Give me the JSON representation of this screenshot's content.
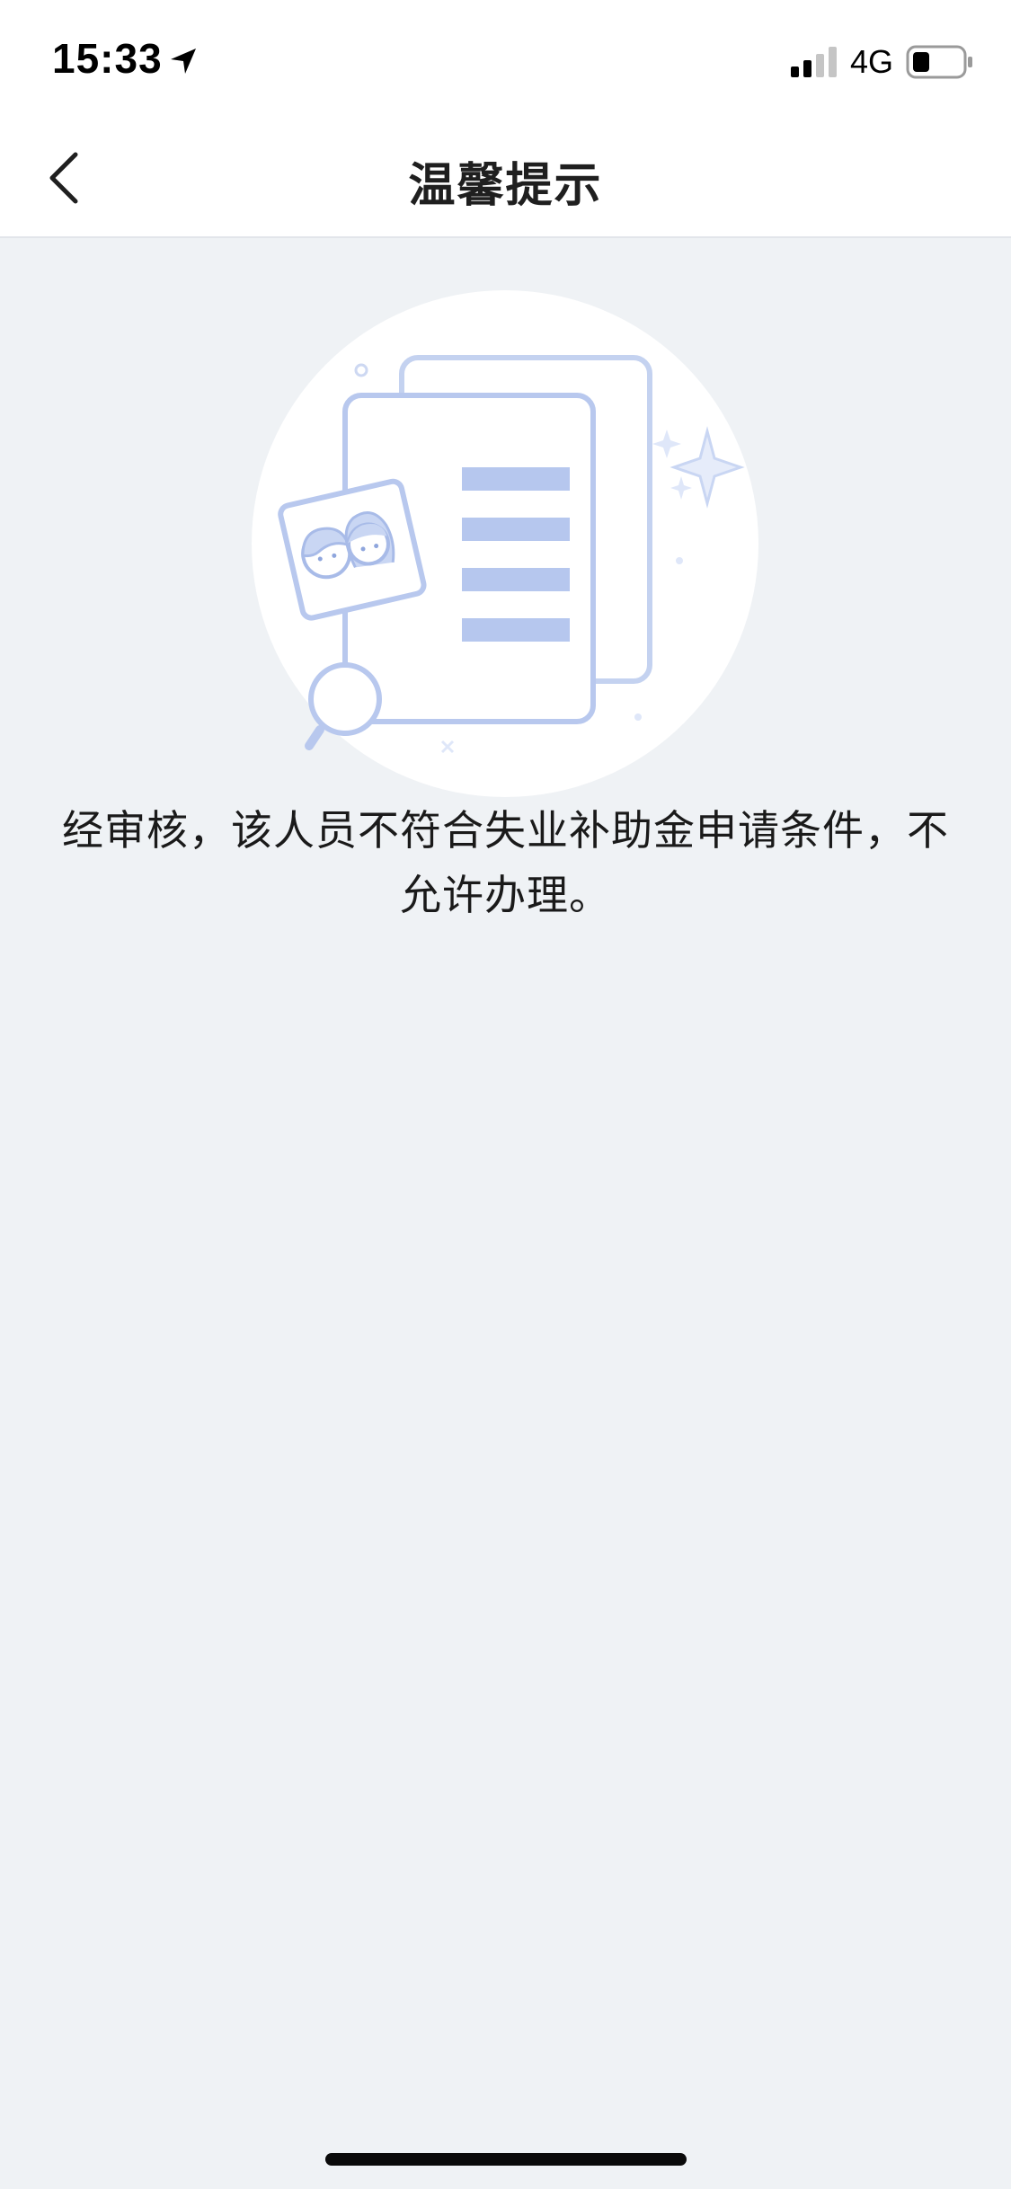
{
  "status_bar": {
    "time": "15:33",
    "network": "4G",
    "location_icon": "location-arrow-icon",
    "signal_icon": "cellular-signal-icon",
    "battery_icon": "battery-icon"
  },
  "nav": {
    "title": "温馨提示",
    "back_icon": "chevron-left-icon"
  },
  "illustration": {
    "icon": "document-review-illustration"
  },
  "message": {
    "text": "经审核，该人员不符合失业补助金申请条件，不允许办理。"
  },
  "colors": {
    "page_background": "#eff2f5",
    "bar_background": "#ffffff",
    "illustration_accent": "#b8c8ee",
    "text": "#1a1a1a"
  }
}
